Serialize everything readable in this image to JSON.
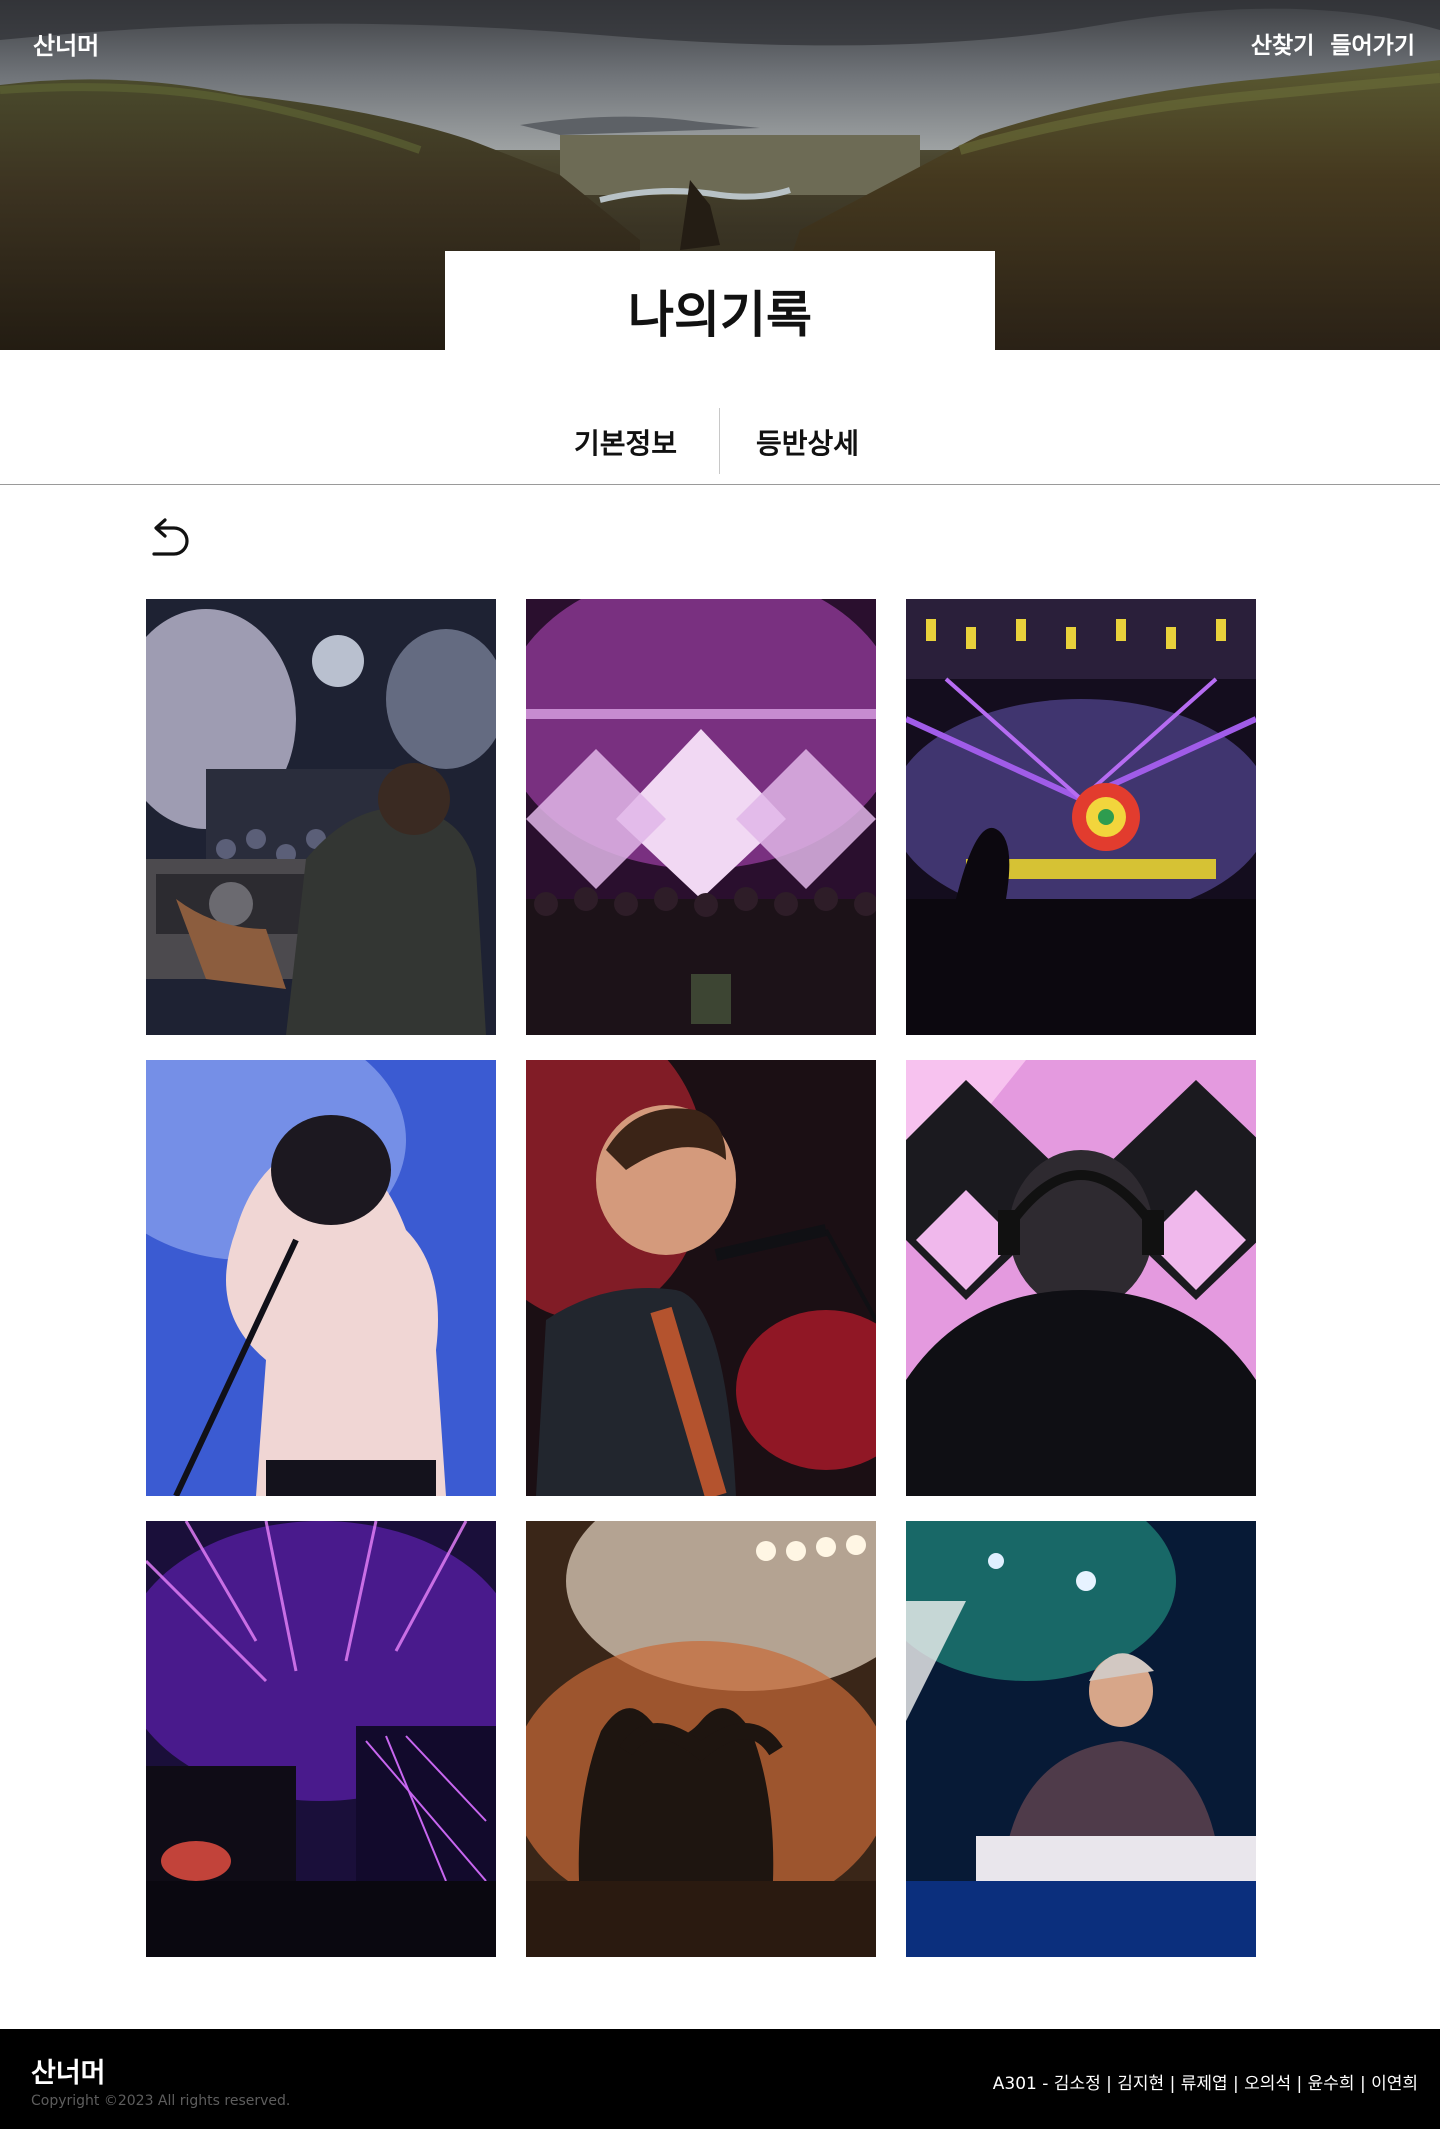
{
  "header": {
    "logo": "산너머",
    "nav": {
      "find_mountain": "산찾기",
      "login": "들어가기"
    }
  },
  "page": {
    "title": "나의기록"
  },
  "tabs": [
    {
      "label": "기본정보"
    },
    {
      "label": "등반상세"
    }
  ],
  "back": {
    "icon": "back-arrow-icon"
  },
  "gallery": {
    "photos": [
      {
        "subject": "dj-crowd"
      },
      {
        "subject": "stage-lights-crowd"
      },
      {
        "subject": "festival-stage"
      },
      {
        "subject": "female-singer"
      },
      {
        "subject": "male-singer-guitar"
      },
      {
        "subject": "dj-headphones"
      },
      {
        "subject": "dj-laser-lights"
      },
      {
        "subject": "heart-hands-crowd"
      },
      {
        "subject": "dj-mixer"
      }
    ]
  },
  "footer": {
    "logo": "산너머",
    "copyright": "Copyright ©2023 All rights reserved.",
    "team": "A301 - 김소정 | 김지현 | 류제엽 | 오의석 | 윤수희 | 이연희"
  },
  "colors": {
    "footer_bg": "#000000",
    "page_bg": "#ffffff",
    "text": "#111111"
  }
}
